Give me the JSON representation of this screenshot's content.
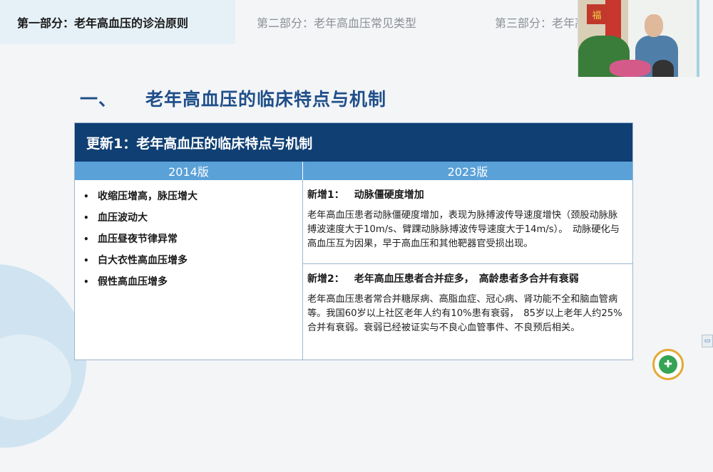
{
  "nav": {
    "tabs": [
      {
        "label": "第一部分：老年高血压的诊治原则"
      },
      {
        "label": "第二部分：老年高血压常见类型"
      },
      {
        "label": "第三部分：老年高血压"
      }
    ]
  },
  "section": {
    "number": "一、",
    "title": "老年高血压的临床特点与机制"
  },
  "table": {
    "header": "更新1：老年高血压的临床特点与机制",
    "col_left": "2014版",
    "col_right": "2023版",
    "left_items": [
      "收缩压增高，脉压增大",
      "血压波动大",
      "血压昼夜节律异常",
      "白大衣性高血压增多",
      "假性高血压增多"
    ],
    "right_blocks": [
      {
        "label": "新增1：",
        "title": "动脉僵硬度增加",
        "text": "老年高血压患者动脉僵硬度增加，表现为脉搏波传导速度增快（颈股动脉脉搏波速度大于10m/s、臂踝动脉脉搏波传导速度大于14m/s）。　动脉硬化与高血压互为因果，早于高血压和其他靶器官受损出现。"
      },
      {
        "label": "新增2：",
        "title": "老年高血压患者合并症多，　高龄患者多合并有衰弱",
        "text": "老年高血压患者常合并糖尿病、高脂血症、冠心病、肾功能不全和脑血管病等。我国60岁以上社区老年人约有10%患有衰弱，　85岁以上老年人约25%合并有衰弱。衰弱已经被证实与不良心血管事件、不良预后相关。"
      }
    ]
  },
  "bullet_glyph": "•",
  "colors": {
    "header_bg": "#0f3f73",
    "col_head_bg": "#5aa1d8",
    "title_color": "#1f4f8a"
  },
  "icons": {
    "scroll": "scroll-toggle-icon",
    "logo": "hospital-logo-icon"
  }
}
